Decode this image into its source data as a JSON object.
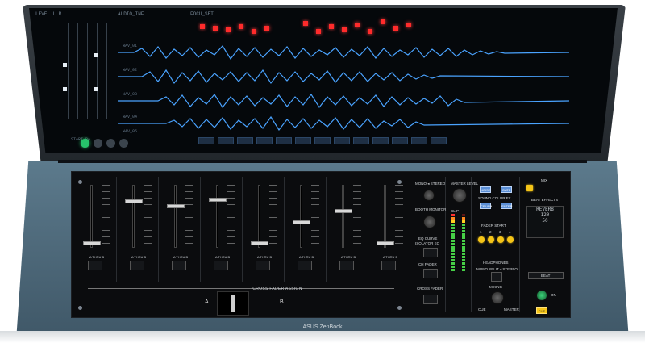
{
  "screen": {
    "top_labels": [
      "LEVEL L R",
      "AUDIO_INF",
      "FOCU_SET"
    ],
    "tracks": [
      {
        "label": "WAV_01",
        "color": "#4aa3ff"
      },
      {
        "label": "WAV_02",
        "color": "#4aa3ff"
      },
      {
        "label": "WAV_03",
        "color": "#4aa3ff"
      },
      {
        "label": "WAV_04",
        "color": "#4aa3ff"
      },
      {
        "label": "WAV_05",
        "color": "#4aa3ff"
      }
    ],
    "status_label": "START BA"
  },
  "mixer": {
    "channel_switch_label": "A  THRU  B",
    "cross_fader_assign": "CROSS FADER ASSIGN",
    "side_a": "A",
    "side_b": "B",
    "monitor": {
      "mono_stereo": "MONO  ◂  STEREO",
      "booth_monitor": "BOOTH MONITOR",
      "eq_curve": "EQ CURVE",
      "eq_sub": "ISOLATOR   EQ",
      "ch_fader": "CH FADER",
      "cross_fader": "CROSS FADER"
    },
    "master": {
      "label": "MASTER LEVEL",
      "clip": "CLIP"
    },
    "fx": {
      "title": "SOUND COLOR FX",
      "buttons": [
        "NOISE",
        "GATE",
        "CRUSH",
        "FILTER"
      ],
      "fader_start": "FADER START",
      "fader_start_nums": [
        "1",
        "2",
        "3",
        "4"
      ],
      "headphones": "HEADPHONES",
      "hp_sub": "MONO SPLIT  ◂  STEREO",
      "mixing": "MIXING",
      "cue": "CUE",
      "master_label": "MASTER"
    },
    "effects": {
      "mix": "MIX",
      "beat_effects": "BEAT EFFECTS",
      "lcd_name": "REVERB",
      "lcd_bpm": "120",
      "lcd_val": "50",
      "beat_label": "BEAT",
      "on_label": "ON",
      "cue_label": "CUE"
    }
  },
  "brand": "ASUS ZenBook"
}
